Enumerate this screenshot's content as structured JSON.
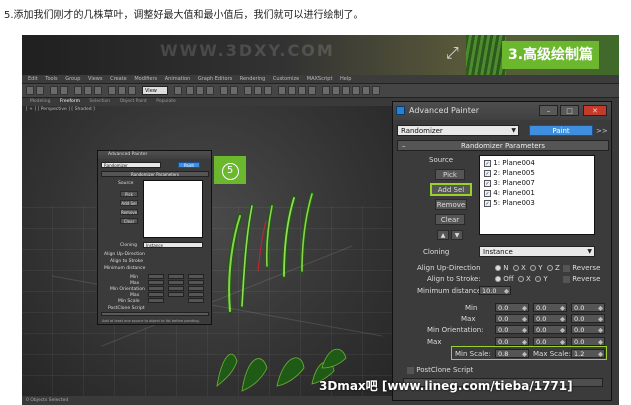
{
  "caption": "5.添加我们刚才的几株草叶，调整好最大值和最小值后，我们就可以进行绘制了。",
  "banner": {
    "title": "3.高级绘制篇",
    "watermark": "WWW.3DXY.COM"
  },
  "menubar": [
    "Edit",
    "Tools",
    "Group",
    "Views",
    "Create",
    "Modifiers",
    "Animation",
    "Graph Editors",
    "Rendering",
    "Customize",
    "MAXScript",
    "Help"
  ],
  "toolbar_select": "View",
  "ribbon": [
    "Modeling",
    "Freeform",
    "Selection",
    "Object Paint",
    "Populate"
  ],
  "ribbon_active": 1,
  "viewport_label": "[ + ] [ Perspective ] [ Shaded ]",
  "status_text": "0 Objects Selected",
  "step_badge": "5",
  "credit": "3Dmax吧  [www.lineg.com/tieba/1771]",
  "small_dialog": {
    "title": "Advanced Painter",
    "mode": "Randomizer",
    "paint": "Paint",
    "section": "Randomizer Parameters",
    "source": "Source",
    "buttons": [
      "Pick",
      "Add Sel",
      "Remove",
      "Clear"
    ],
    "cloning_label": "Cloning",
    "cloning_value": "Instance",
    "rows": [
      "Align Up-Direction",
      "Align to Stroke",
      "Minimum distance",
      "Min",
      "Max",
      "Min Orientation",
      "Max",
      "Min Scale"
    ],
    "postclone": "PostClone Script",
    "footer": "Add at least one source to object to list before painting."
  },
  "dialog": {
    "title": "Advanced Painter",
    "controls": [
      "–",
      "□",
      "✕"
    ],
    "mode_select": "Randomizer",
    "paint_button": "Paint",
    "more": ">>",
    "rollout": "Randomizer Parameters",
    "rollout_sign": "–",
    "source_label": "Source",
    "buttons": {
      "pick": "Pick",
      "add_sel": "Add Sel",
      "remove": "Remove",
      "clear": "Clear"
    },
    "source_list": [
      "1: Plane004",
      "2: Plane005",
      "3: Plane007",
      "4: Plane001",
      "5: Plane003"
    ],
    "check_mark": "✓",
    "cloning_label": "Cloning",
    "cloning_value": "Instance",
    "align_up_label": "Align Up-Direction",
    "align_up_options": [
      "N",
      "X",
      "Y",
      "Z"
    ],
    "align_up_selected": 0,
    "align_stroke_label": "Align to Stroke:",
    "align_stroke_options": [
      "Off",
      "X",
      "Y"
    ],
    "align_stroke_selected": 0,
    "reverse": "Reverse",
    "min_distance_label": "Minimum distance:",
    "min_distance_value": "10.0",
    "min_label": "Min",
    "max_label": "Max",
    "min_orient_label": "Min Orientation:",
    "max_orient_label": "Max",
    "min_scale_label": "Min Scale:",
    "min_scale_value": "0.8",
    "max_scale_label": "Max Scale:",
    "max_scale_value": "1.2",
    "zero": "0.0",
    "postclone": "PostClone Script"
  }
}
